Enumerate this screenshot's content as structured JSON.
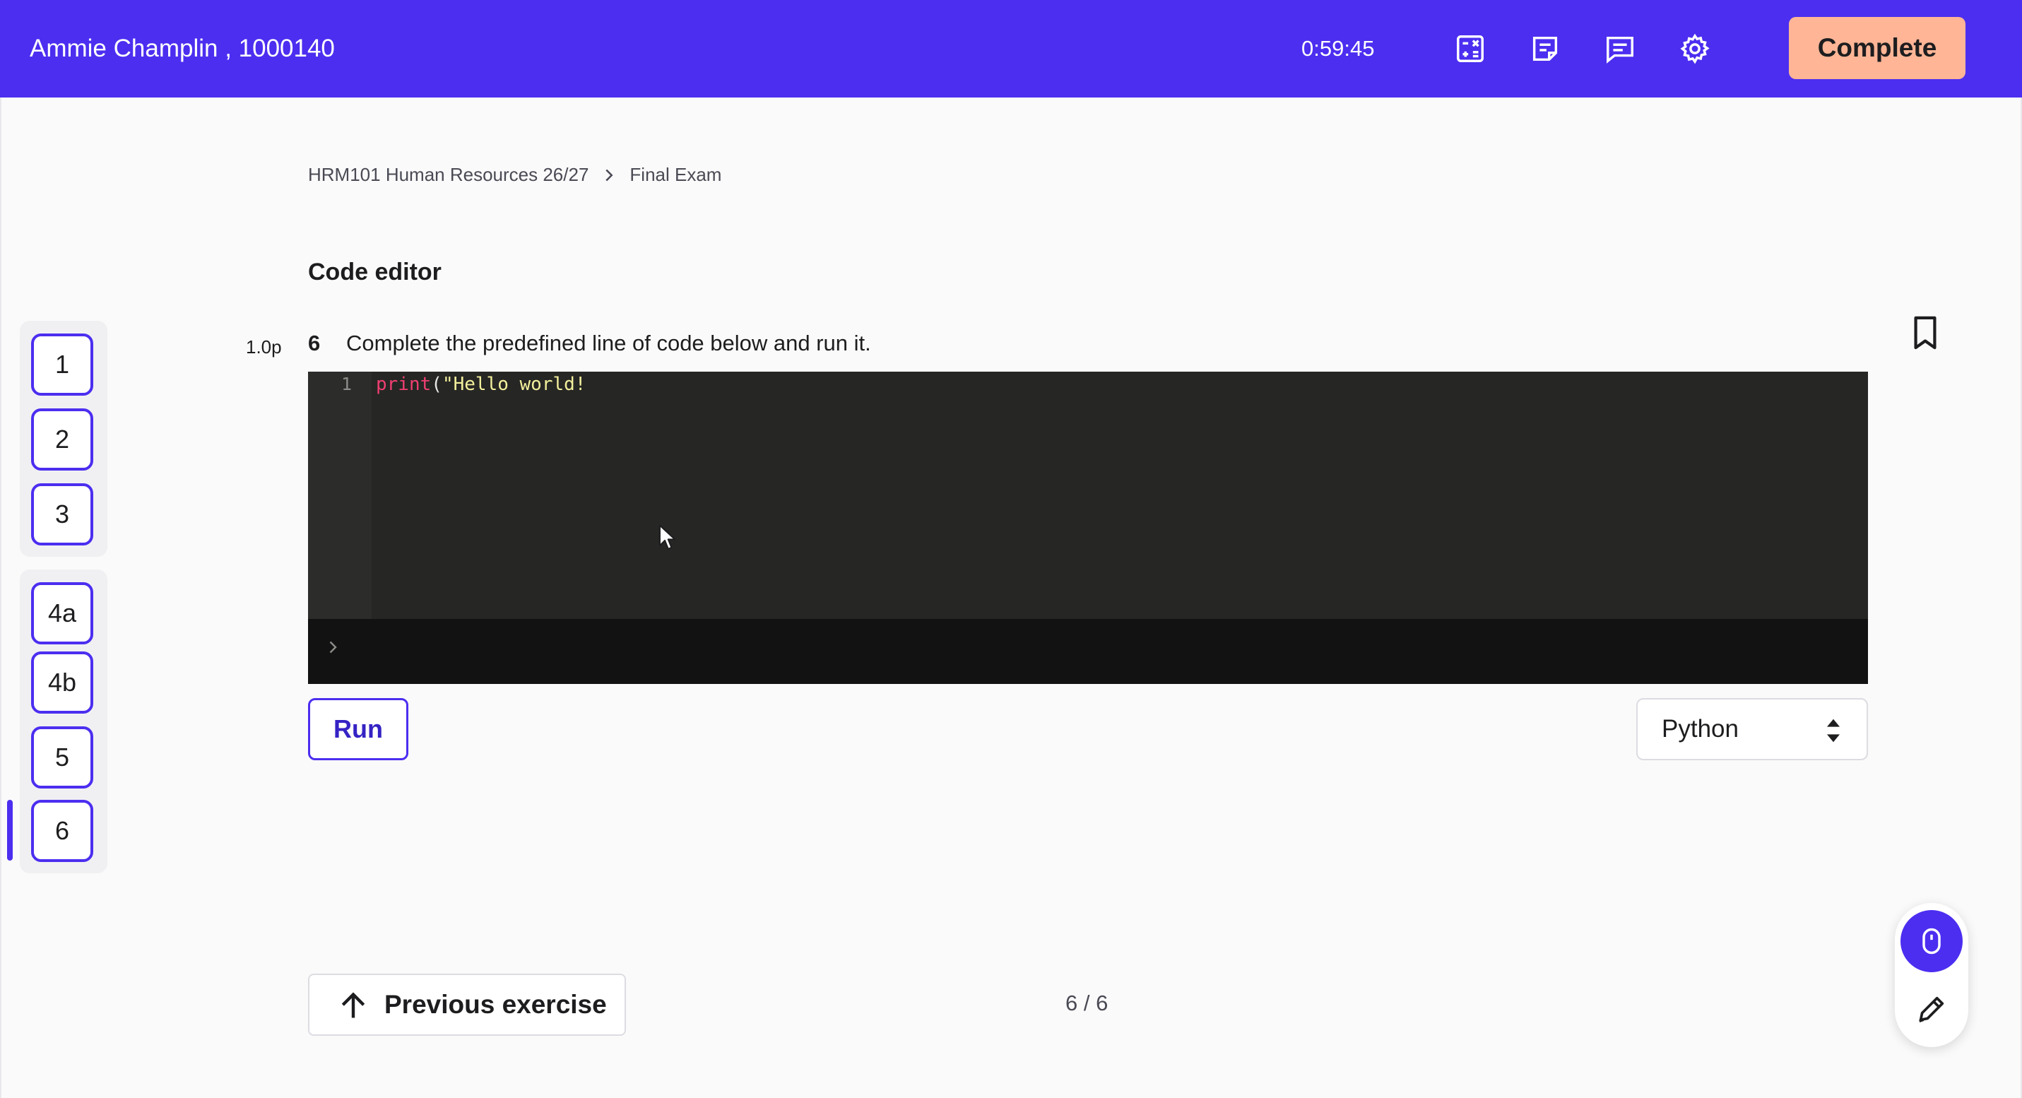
{
  "header": {
    "user_label": "Ammie Champlin , 1000140",
    "timer": "0:59:45",
    "tools": [
      "calculator-icon",
      "notes-icon",
      "chat-icon",
      "gear-icon"
    ],
    "complete_label": "Complete",
    "bg_color": "#4b2ef0",
    "complete_color": "#ffb596"
  },
  "breadcrumb": {
    "course": "HRM101 Human Resources 26/27",
    "exam": "Final Exam"
  },
  "page_title": "Code editor",
  "question_nav": {
    "group1": [
      "1",
      "2",
      "3"
    ],
    "group2": [
      "4a",
      "4b",
      "5",
      "6"
    ],
    "active": "6"
  },
  "question": {
    "points": "1.0p",
    "number": "6",
    "text": "Complete the predefined line of code below and run it."
  },
  "editor": {
    "line_number": "1",
    "code_keyword": "print",
    "code_paren": "(",
    "code_string": "\"Hello world!"
  },
  "run_label": "Run",
  "language": {
    "selected": "Python"
  },
  "footer": {
    "prev_label": "Previous exercise",
    "page_count": "6 / 6"
  }
}
